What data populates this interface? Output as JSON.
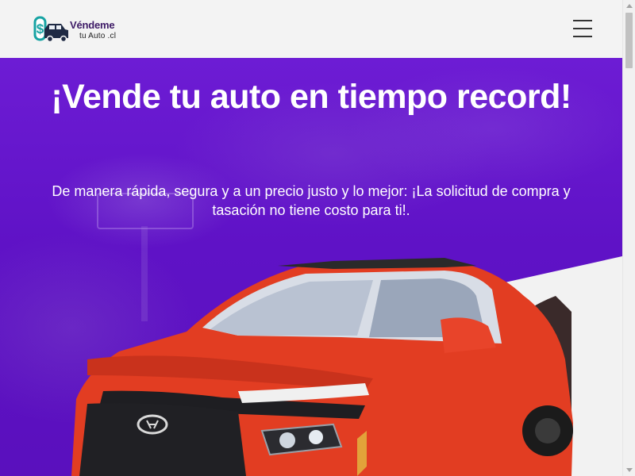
{
  "header": {
    "logo_line1": "Véndeme",
    "logo_line2": "tu Auto .cl",
    "menu_icon": "hamburger-menu-icon"
  },
  "hero": {
    "title": "¡Vende tu auto en tiempo record!",
    "subtitle": "De manera rápida, segura y a un precio justo y lo mejor: ¡La solicitud de compra y tasación no tiene costo para ti!.",
    "car_icon": "red-suv-image"
  },
  "colors": {
    "hero_purple": "#6419cc",
    "logo_teal": "#17a3a3",
    "logo_navy": "#1f2a44",
    "car_red": "#e23d22",
    "white_band": "#f2f2f2"
  }
}
